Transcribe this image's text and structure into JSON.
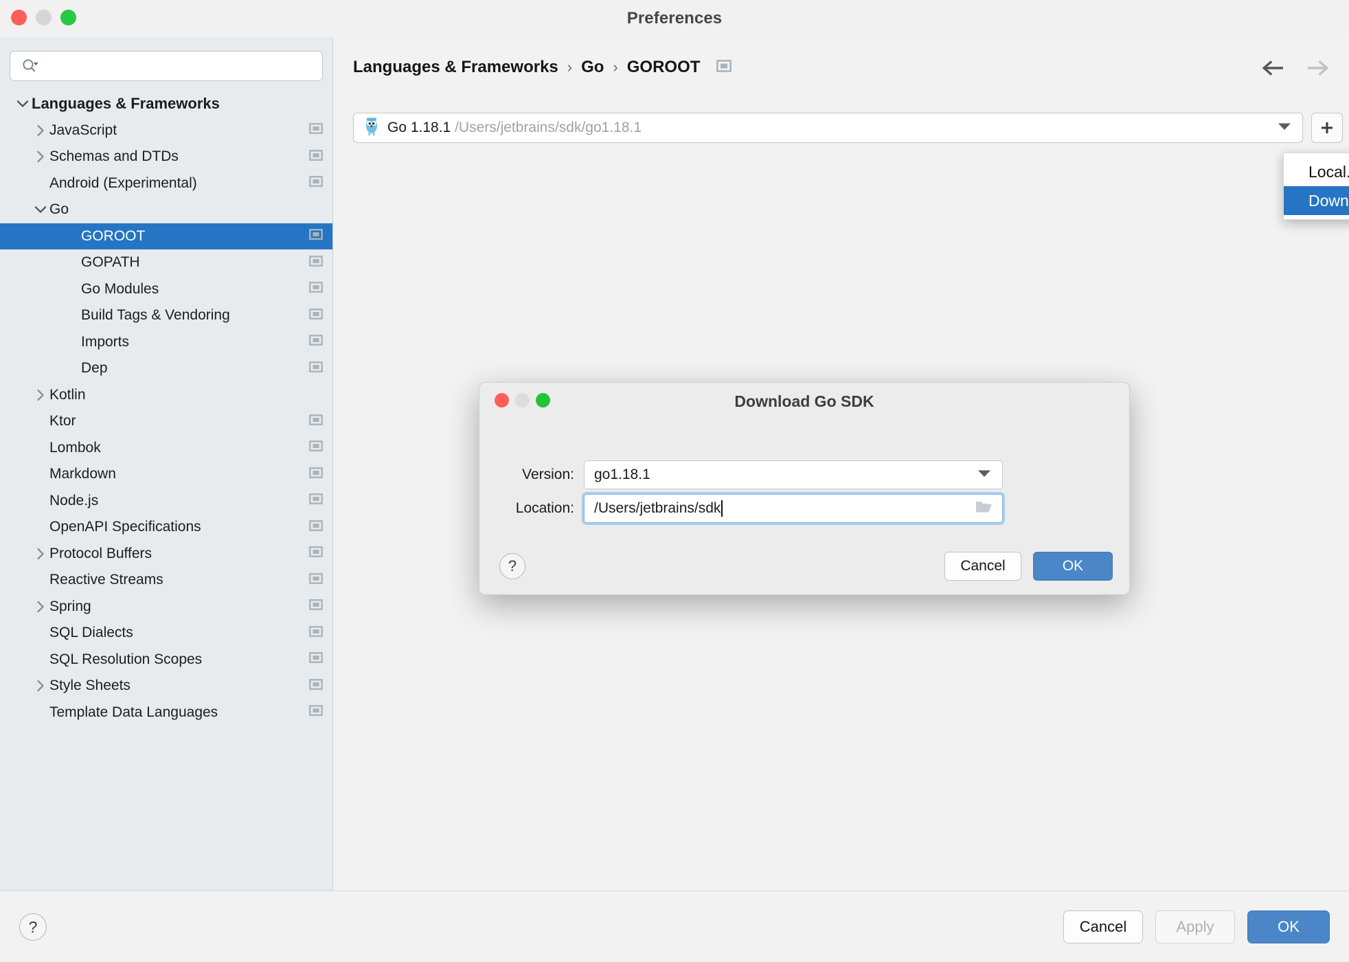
{
  "window": {
    "title": "Preferences",
    "traffic_lights": [
      "close",
      "minimize",
      "zoom"
    ]
  },
  "sidebar": {
    "search": {
      "value": "",
      "placeholder": ""
    },
    "items": [
      {
        "label": "Languages & Frameworks",
        "depth": 0,
        "twisty": "down",
        "gear": false,
        "selected": false,
        "bold": true
      },
      {
        "label": "JavaScript",
        "depth": 1,
        "twisty": "right",
        "gear": true,
        "selected": false,
        "bold": false
      },
      {
        "label": "Schemas and DTDs",
        "depth": 1,
        "twisty": "right",
        "gear": true,
        "selected": false,
        "bold": false
      },
      {
        "label": "Android (Experimental)",
        "depth": 1,
        "twisty": "none",
        "gear": true,
        "selected": false,
        "bold": false
      },
      {
        "label": "Go",
        "depth": 1,
        "twisty": "down",
        "gear": false,
        "selected": false,
        "bold": false
      },
      {
        "label": "GOROOT",
        "depth": 2,
        "twisty": "none",
        "gear": true,
        "selected": true,
        "bold": false
      },
      {
        "label": "GOPATH",
        "depth": 2,
        "twisty": "none",
        "gear": true,
        "selected": false,
        "bold": false
      },
      {
        "label": "Go Modules",
        "depth": 2,
        "twisty": "none",
        "gear": true,
        "selected": false,
        "bold": false
      },
      {
        "label": "Build Tags & Vendoring",
        "depth": 2,
        "twisty": "none",
        "gear": true,
        "selected": false,
        "bold": false
      },
      {
        "label": "Imports",
        "depth": 2,
        "twisty": "none",
        "gear": true,
        "selected": false,
        "bold": false
      },
      {
        "label": "Dep",
        "depth": 2,
        "twisty": "none",
        "gear": true,
        "selected": false,
        "bold": false
      },
      {
        "label": "Kotlin",
        "depth": 1,
        "twisty": "right",
        "gear": false,
        "selected": false,
        "bold": false
      },
      {
        "label": "Ktor",
        "depth": 1,
        "twisty": "none",
        "gear": true,
        "selected": false,
        "bold": false
      },
      {
        "label": "Lombok",
        "depth": 1,
        "twisty": "none",
        "gear": true,
        "selected": false,
        "bold": false
      },
      {
        "label": "Markdown",
        "depth": 1,
        "twisty": "none",
        "gear": true,
        "selected": false,
        "bold": false
      },
      {
        "label": "Node.js",
        "depth": 1,
        "twisty": "none",
        "gear": true,
        "selected": false,
        "bold": false
      },
      {
        "label": "OpenAPI Specifications",
        "depth": 1,
        "twisty": "none",
        "gear": true,
        "selected": false,
        "bold": false
      },
      {
        "label": "Protocol Buffers",
        "depth": 1,
        "twisty": "right",
        "gear": true,
        "selected": false,
        "bold": false
      },
      {
        "label": "Reactive Streams",
        "depth": 1,
        "twisty": "none",
        "gear": true,
        "selected": false,
        "bold": false
      },
      {
        "label": "Spring",
        "depth": 1,
        "twisty": "right",
        "gear": true,
        "selected": false,
        "bold": false
      },
      {
        "label": "SQL Dialects",
        "depth": 1,
        "twisty": "none",
        "gear": true,
        "selected": false,
        "bold": false
      },
      {
        "label": "SQL Resolution Scopes",
        "depth": 1,
        "twisty": "none",
        "gear": true,
        "selected": false,
        "bold": false
      },
      {
        "label": "Style Sheets",
        "depth": 1,
        "twisty": "right",
        "gear": true,
        "selected": false,
        "bold": false
      },
      {
        "label": "Template Data Languages",
        "depth": 1,
        "twisty": "none",
        "gear": true,
        "selected": false,
        "bold": false
      }
    ]
  },
  "main": {
    "breadcrumb": [
      "Languages & Frameworks",
      "Go",
      "GOROOT"
    ],
    "breadcrumb_separator": "›",
    "nav": {
      "back": "back-arrow",
      "forward": "forward-arrow"
    },
    "sdk_combo": {
      "icon": "go-gopher-icon",
      "name": "Go 1.18.1",
      "path": "/Users/jetbrains/sdk/go1.18.1"
    },
    "add_button_label": "+",
    "popup_menu": {
      "items": [
        {
          "label": "Local...",
          "active": false
        },
        {
          "label": "Download...",
          "active": true
        }
      ]
    }
  },
  "dialog": {
    "title": "Download Go SDK",
    "version": {
      "label": "Version:",
      "value": "go1.18.1"
    },
    "location": {
      "label": "Location:",
      "value": "/Users/jetbrains/sdk"
    },
    "help_label": "?",
    "cancel_label": "Cancel",
    "ok_label": "OK"
  },
  "footer": {
    "help_label": "?",
    "cancel_label": "Cancel",
    "apply_label": "Apply",
    "ok_label": "OK"
  },
  "colors": {
    "accent": "#2675c4",
    "primary_button": "#4a86c8",
    "sidebar_bg": "#e7ebee",
    "window_bg": "#f2f2f2",
    "traffic_red": "#ff5f57",
    "traffic_yellow": "#d6d6d6",
    "traffic_green": "#28c840"
  }
}
